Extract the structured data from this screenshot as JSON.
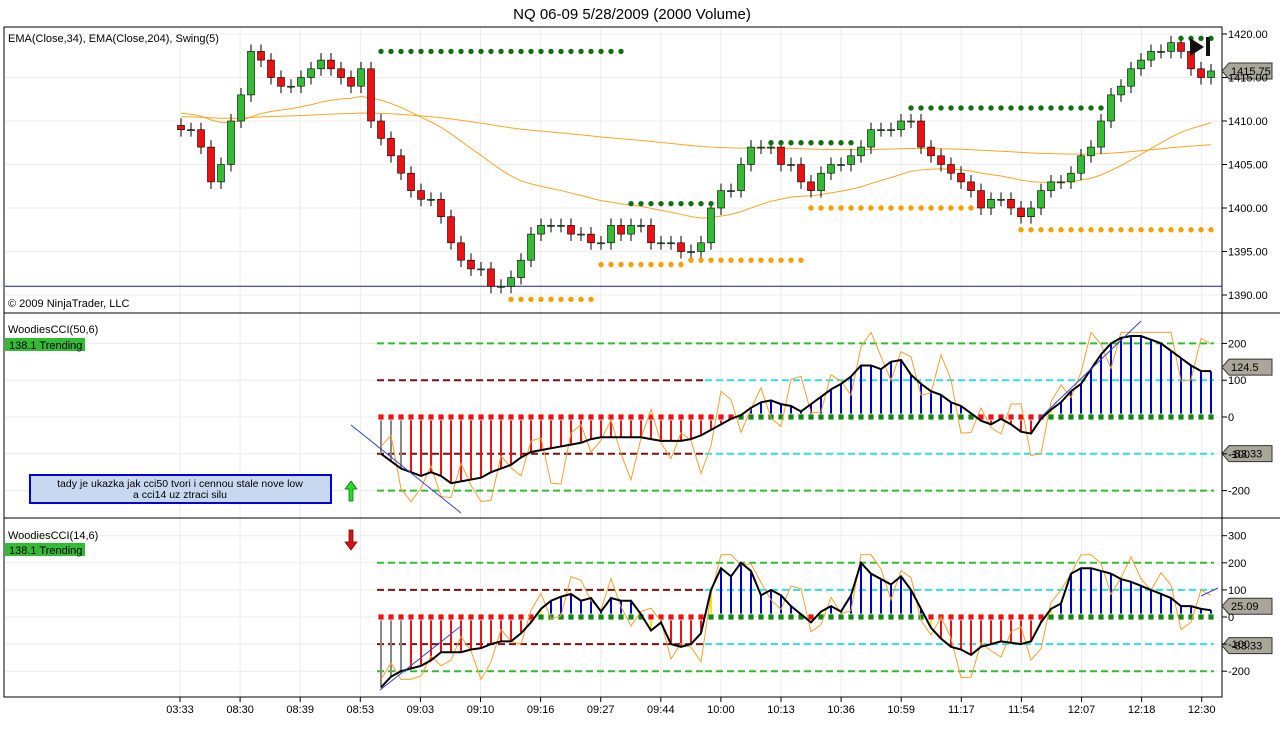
{
  "title": "NQ 06-09  5/28/2009 (2000 Volume)",
  "colors": {
    "up": "#33bb33",
    "down": "#ee1111",
    "ema": "#f5a623",
    "swing_high": "#107010",
    "swing_low": "#f5a000",
    "hline": "#1a1aa0",
    "cci_up": "#0000cc",
    "cci_down": "#ee1111",
    "trend_badge": "#33bb33"
  },
  "chart_data": [
    {
      "type": "candlestick",
      "title": "EMA(Close,34), EMA(Close,204), Swing(5)",
      "copyright": "© 2009 NinjaTrader, LLC",
      "ylim": [
        1388,
        1421
      ],
      "yticks": [
        "1420.00",
        "1415.00",
        "1410.00",
        "1405.00",
        "1400.00",
        "1395.00",
        "1390.00"
      ],
      "ytick_values": [
        1420,
        1415,
        1410,
        1405,
        1400,
        1395,
        1390
      ],
      "last_price": "1415.75",
      "horizontal_line": 1391,
      "closes": [
        1409,
        1409,
        1407,
        1403,
        1405,
        1410,
        1413,
        1418,
        1417,
        1415,
        1414,
        1414,
        1415,
        1416,
        1417,
        1416,
        1415,
        1414,
        1416,
        1410,
        1408,
        1406,
        1404,
        1402,
        1401,
        1401,
        1399,
        1396,
        1394,
        1393,
        1393,
        1391,
        1391,
        1392,
        1394,
        1397,
        1398,
        1398,
        1398,
        1397,
        1397,
        1396,
        1396,
        1398,
        1397,
        1398,
        1398,
        1396,
        1396,
        1396,
        1395,
        1395,
        1396,
        1400,
        1402,
        1402,
        1405,
        1407,
        1407,
        1407,
        1405,
        1405,
        1403,
        1402,
        1404,
        1405,
        1405,
        1406,
        1407,
        1409,
        1409,
        1409,
        1410,
        1410,
        1407,
        1406,
        1405,
        1404,
        1403,
        1402,
        1400,
        1401,
        1401,
        1400,
        1399,
        1400,
        1402,
        1403,
        1403,
        1404,
        1406,
        1407,
        1410,
        1413,
        1414,
        1416,
        1417,
        1418,
        1418,
        1419,
        1418,
        1416,
        1415,
        1415.75
      ],
      "swing_highs": [
        {
          "price": 1418,
          "from": 20,
          "to": 44
        },
        {
          "price": 1400.5,
          "from": 45,
          "to": 53
        },
        {
          "price": 1407.5,
          "from": 59,
          "to": 67
        },
        {
          "price": 1411.5,
          "from": 73,
          "to": 92
        },
        {
          "price": 1419.5,
          "from": 100,
          "to": 103
        }
      ],
      "swing_lows": [
        {
          "price": 1389.5,
          "from": 33,
          "to": 41
        },
        {
          "price": 1393.5,
          "from": 42,
          "to": 50
        },
        {
          "price": 1394,
          "from": 51,
          "to": 62
        },
        {
          "price": 1400,
          "from": 63,
          "to": 79
        },
        {
          "price": 1397.5,
          "from": 84,
          "to": 103
        }
      ]
    },
    {
      "type": "bar",
      "title": "WoodiesCCI(50,6)",
      "badge": "138.1 Trending",
      "ylim": [
        -260,
        260
      ],
      "yticks": [
        "200",
        "100",
        "0",
        "-100",
        "-200"
      ],
      "ytick_values": [
        200,
        100,
        0,
        -100,
        -200
      ],
      "last_value": "124.5",
      "turbo_value": "-83.33",
      "start_bar": 20,
      "values": [
        -100,
        -120,
        -140,
        -150,
        -160,
        -150,
        -160,
        -180,
        -175,
        -170,
        -165,
        -150,
        -140,
        -130,
        -110,
        -95,
        -90,
        -85,
        -80,
        -75,
        -70,
        -60,
        -55,
        -55,
        -55,
        -55,
        -55,
        -60,
        -65,
        -65,
        -65,
        -60,
        -50,
        -35,
        -20,
        -5,
        5,
        25,
        40,
        45,
        35,
        30,
        15,
        35,
        55,
        75,
        90,
        110,
        140,
        140,
        130,
        150,
        155,
        115,
        90,
        70,
        60,
        40,
        30,
        10,
        -10,
        -20,
        -5,
        -20,
        -40,
        -45,
        -5,
        20,
        40,
        70,
        90,
        130,
        170,
        200,
        215,
        220,
        220,
        210,
        200,
        180,
        160,
        140,
        125,
        124.5
      ],
      "annotation": [
        "tady je ukazka jak cci50 tvori  i cennou stale nove low",
        "a cci14 uz ztraci silu"
      ]
    },
    {
      "type": "bar",
      "title": "WoodiesCCI(14,6)",
      "badge": "138.1 Trending",
      "ylim": [
        -290,
        330
      ],
      "yticks": [
        "300",
        "200",
        "100",
        "0",
        "-100",
        "-200"
      ],
      "ytick_values": [
        300,
        200,
        100,
        0,
        -100,
        -200
      ],
      "last_value": "25.09",
      "turbo_value": "-83.33",
      "start_bar": 20,
      "values": [
        -260,
        -220,
        -200,
        -190,
        -180,
        -160,
        -130,
        -130,
        -130,
        -120,
        -115,
        -100,
        -90,
        -90,
        -60,
        -20,
        30,
        60,
        75,
        85,
        60,
        70,
        20,
        70,
        60,
        60,
        10,
        -50,
        -20,
        -100,
        -110,
        -100,
        -60,
        100,
        180,
        150,
        200,
        170,
        80,
        100,
        80,
        40,
        10,
        -20,
        20,
        40,
        20,
        80,
        200,
        160,
        140,
        120,
        150,
        100,
        30,
        -40,
        -80,
        -110,
        -120,
        -140,
        -110,
        -100,
        -90,
        -95,
        -100,
        -90,
        -20,
        30,
        50,
        160,
        180,
        180,
        170,
        160,
        140,
        130,
        115,
        100,
        85,
        70,
        40,
        40,
        30,
        25.09
      ]
    }
  ],
  "x_axis": {
    "labels": [
      "03:33",
      "08:30",
      "08:39",
      "08:53",
      "09:03",
      "09:10",
      "09:16",
      "09:27",
      "09:44",
      "10:00",
      "10:13",
      "10:36",
      "10:59",
      "11:17",
      "11:54",
      "12:07",
      "12:18",
      "12:30"
    ]
  }
}
